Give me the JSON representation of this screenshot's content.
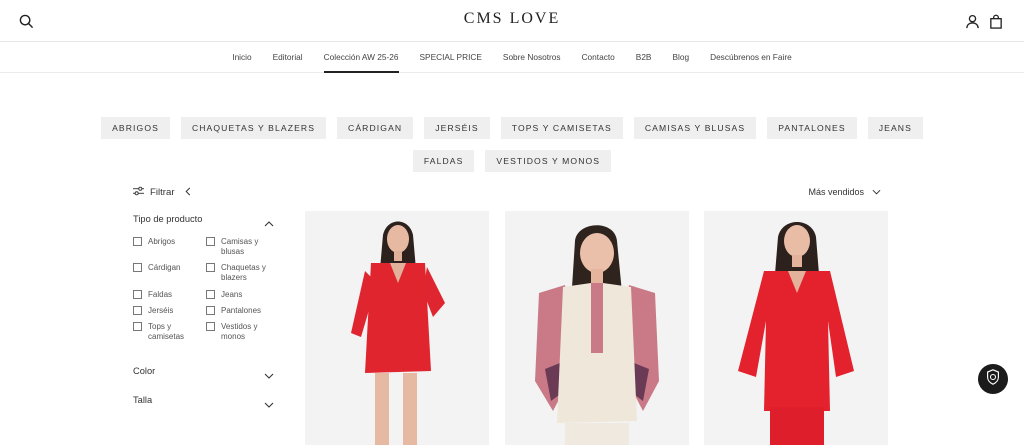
{
  "header": {
    "logo": "CMS LOVE",
    "icons": [
      "search-icon",
      "account-icon",
      "cart-icon"
    ]
  },
  "nav": {
    "items": [
      {
        "label": "Inicio"
      },
      {
        "label": "Editorial"
      },
      {
        "label": "Colección AW 25-26"
      },
      {
        "label": "SPECIAL PRICE"
      },
      {
        "label": "Sobre Nosotros"
      },
      {
        "label": "Contacto"
      },
      {
        "label": "B2B"
      },
      {
        "label": "Blog"
      },
      {
        "label": "Descúbrenos en Faire"
      }
    ],
    "active_index": 2
  },
  "categories": {
    "row1": [
      "ABRIGOS",
      "CHAQUETAS Y BLAZERS",
      "CÁRDIGAN",
      "JERSÉIS",
      "TOPS Y CAMISETAS",
      "CAMISAS Y BLUSAS",
      "PANTALONES",
      "JEANS"
    ],
    "row2": [
      "FALDAS",
      "VESTIDOS Y MONOS"
    ]
  },
  "filter": {
    "label": "Filtrar",
    "sections": {
      "product_type": "Tipo de producto",
      "color": "Color",
      "size": "Talla"
    },
    "options_left": [
      "Abrigos",
      "Cárdigan",
      "Faldas",
      "Jerséis",
      "Tops y camisetas"
    ],
    "options_right": [
      "Camisas y blusas",
      "Chaquetas y blazers",
      "Jeans",
      "Pantalones",
      "Vestidos y monos"
    ]
  },
  "sort": {
    "label": "Más vendidos"
  },
  "products": [
    {
      "image": "model-red-dress",
      "colors": {
        "garment": "#e0252f"
      }
    },
    {
      "image": "model-white-vest-pink-blouse",
      "colors": {
        "garment": "#efe7da"
      }
    },
    {
      "image": "model-red-sweater-skirt",
      "colors": {
        "garment": "#e3222e"
      }
    }
  ],
  "widget": {
    "icon": "shield-badge-icon"
  },
  "colors": {
    "chip_bg": "#efefef",
    "text": "#222222",
    "border": "#e6e6e6"
  }
}
